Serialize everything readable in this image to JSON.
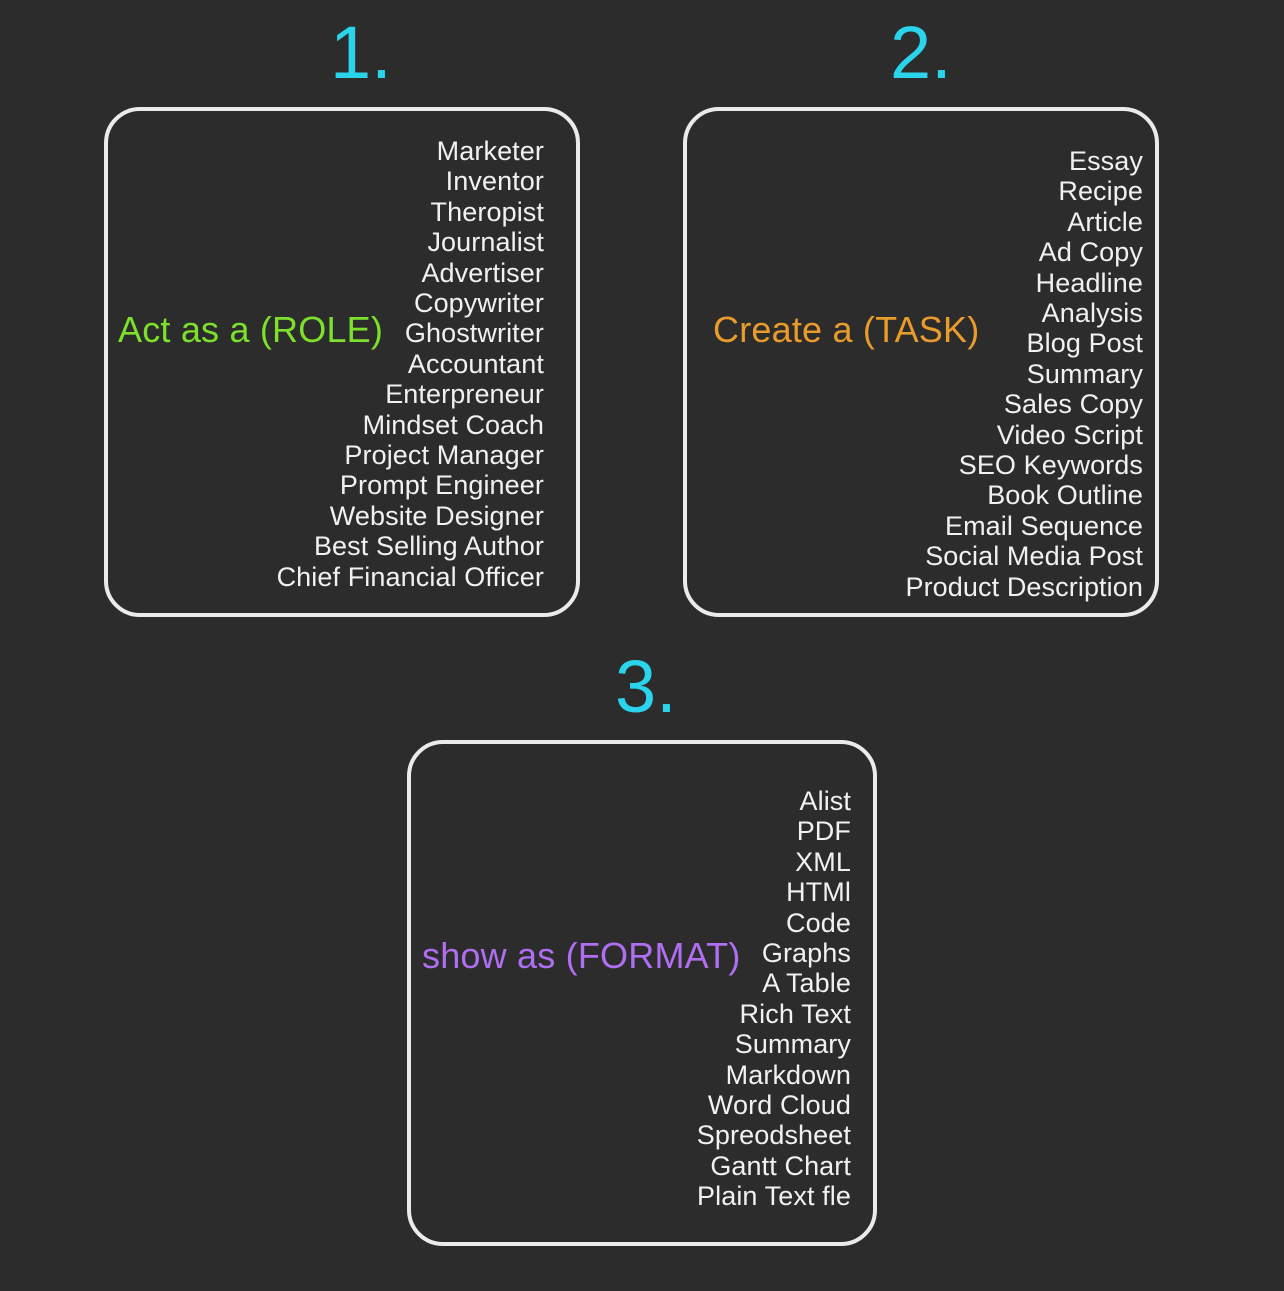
{
  "background_color": "#2c2c2c",
  "accent_colors": {
    "step_number": "#2ad4ea",
    "role": "#7de02c",
    "task": "#e99c2b",
    "format": "#b06ef2",
    "option_text": "#f1f1f1",
    "panel_border": "#eceaea"
  },
  "steps": [
    {
      "number": "1.",
      "label": "Act as a (ROLE)",
      "options": [
        "Marketer",
        "Inventor",
        "Theropist",
        "Journalist",
        "Advertiser",
        "Copywriter",
        "Ghostwriter",
        "Accountant",
        "Enterpreneur",
        "Mindset Coach",
        "Project Manager",
        "Prompt Engineer",
        "Website Designer",
        "Best Selling Author",
        "Chief Financial Officer"
      ]
    },
    {
      "number": "2.",
      "label": "Create a (TASK)",
      "options": [
        "Essay",
        "Recipe",
        "Article",
        "Ad Copy",
        "Headline",
        "Analysis",
        "Blog Post",
        "Summary",
        "Sales Copy",
        "Video Script",
        "SEO Keywords",
        "Book Outline",
        "Email Sequence",
        "Social Media Post",
        "Product Description"
      ]
    },
    {
      "number": "3.",
      "label": "show as (FORMAT)",
      "options": [
        "Alist",
        "PDF",
        "XML",
        "HTMl",
        "Code",
        "Graphs",
        "A Table",
        "Rich Text",
        "Summary",
        "Markdown",
        "Word Cloud",
        "Spreodsheet",
        "Gantt Chart",
        "Plain Text fle"
      ]
    }
  ]
}
